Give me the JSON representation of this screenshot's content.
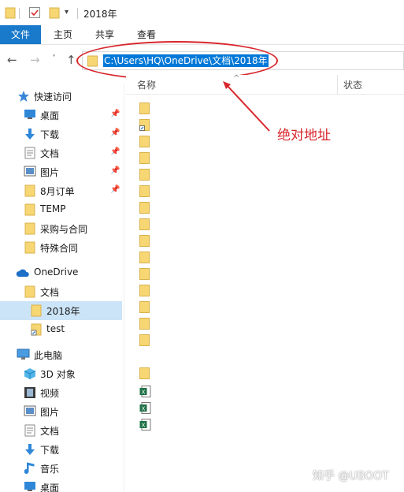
{
  "window": {
    "title": "2018年"
  },
  "ribbon": {
    "tabs": [
      {
        "label": "文件"
      },
      {
        "label": "主页"
      },
      {
        "label": "共享"
      },
      {
        "label": "查看"
      }
    ]
  },
  "address": {
    "path": "C:\\Users\\HQ\\OneDrive\\文档\\2018年"
  },
  "columns": {
    "name": "名称",
    "status": "状态"
  },
  "sidebar": {
    "quick_access": {
      "label": "快速访问"
    },
    "quick_items": [
      {
        "label": "桌面",
        "icon": "desktop-icon",
        "pinned": true
      },
      {
        "label": "下载",
        "icon": "download-icon",
        "pinned": true
      },
      {
        "label": "文档",
        "icon": "document-icon",
        "pinned": true
      },
      {
        "label": "图片",
        "icon": "pictures-icon",
        "pinned": true
      },
      {
        "label": "8月订单",
        "icon": "folder-icon",
        "pinned": true
      },
      {
        "label": "TEMP",
        "icon": "folder-icon",
        "pinned": false
      },
      {
        "label": "采购与合同",
        "icon": "folder-icon",
        "pinned": false
      },
      {
        "label": "特殊合同",
        "icon": "folder-icon",
        "pinned": false
      }
    ],
    "onedrive": {
      "label": "OneDrive"
    },
    "onedrive_items": [
      {
        "label": "文档",
        "icon": "folder-icon"
      },
      {
        "label": "2018年",
        "icon": "folder-icon",
        "selected": true
      },
      {
        "label": "test",
        "icon": "shortcut-icon"
      }
    ],
    "this_pc": {
      "label": "此电脑"
    },
    "pc_items": [
      {
        "label": "3D 对象",
        "icon": "3d-objects-icon"
      },
      {
        "label": "视频",
        "icon": "video-icon"
      },
      {
        "label": "图片",
        "icon": "pictures-icon"
      },
      {
        "label": "文档",
        "icon": "document-icon"
      },
      {
        "label": "下载",
        "icon": "download-icon"
      },
      {
        "label": "音乐",
        "icon": "music-icon"
      },
      {
        "label": "桌面",
        "icon": "desktop-icon"
      }
    ]
  },
  "files": [
    {
      "type": "folder"
    },
    {
      "type": "shortcut"
    },
    {
      "type": "folder"
    },
    {
      "type": "folder"
    },
    {
      "type": "folder"
    },
    {
      "type": "folder"
    },
    {
      "type": "folder"
    },
    {
      "type": "folder"
    },
    {
      "type": "folder"
    },
    {
      "type": "folder"
    },
    {
      "type": "folder"
    },
    {
      "type": "folder"
    },
    {
      "type": "folder"
    },
    {
      "type": "folder"
    },
    {
      "type": "folder"
    },
    {
      "type": "folder"
    },
    {
      "type": "excel"
    },
    {
      "type": "excel"
    },
    {
      "type": "excel"
    }
  ],
  "annotation": {
    "text": "绝对地址",
    "color": "#d8262b"
  },
  "watermark": "知乎 @UBOOT",
  "colors": {
    "accent": "#1979ca",
    "selection": "#0078d7",
    "folder": "#f7d674"
  }
}
